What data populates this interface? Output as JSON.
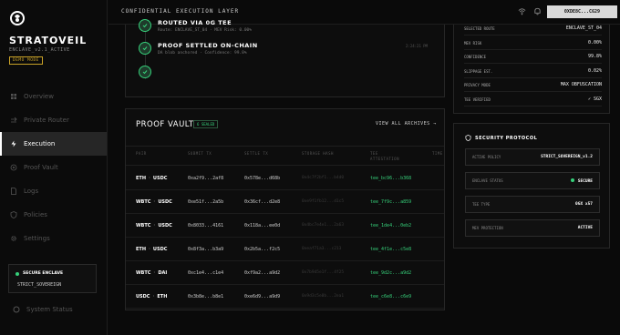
{
  "brand": {
    "name": "STRATOVEIL",
    "enclave": "ENCLAVE_v2.1_ACTIVE",
    "mode_badge": "DEMO MODE"
  },
  "nav": [
    {
      "label": "Overview",
      "icon": "grid-icon"
    },
    {
      "label": "Private Router",
      "icon": "arrows-icon"
    },
    {
      "label": "Execution",
      "icon": "bolt-icon",
      "active": true
    },
    {
      "label": "Proof Vault",
      "icon": "vault-icon"
    },
    {
      "label": "Logs",
      "icon": "document-icon"
    },
    {
      "label": "Policies",
      "icon": "shield-icon"
    },
    {
      "label": "Settings",
      "icon": "gear-icon"
    }
  ],
  "secure_card": {
    "title": "SECURE ENCLAVE",
    "value": "STRICT_SOVEREIGN"
  },
  "system_status": "System Status",
  "topbar": {
    "title": "CONFIDENTIAL EXECUTION LAYER",
    "wallet": "0XDE8C...C629"
  },
  "timeline": [
    {
      "title": "ROUTED VIA 0G TEE",
      "sub": "Route: ENCLAVE_ST_04 · MEV Risk: 0.00%"
    },
    {
      "title": "PROOF SETTLED ON-CHAIN",
      "sub": "DA blob anchored · Confidence: 99.8%"
    }
  ],
  "timeline_time": "2:24:21 PM",
  "vault": {
    "title": "PROOF VAULT",
    "badge": "6 SEALED",
    "link": "VIEW ALL ARCHIVES →",
    "columns": [
      "PAIR",
      "SUBMIT TX",
      "SETTLE TX",
      "STORAGE HASH",
      "TEE ATTESTATION",
      "TIME"
    ],
    "rows": [
      {
        "a": "ETH",
        "b": "USDC",
        "submit": "0xa2f9...2af8",
        "settle": "0x578e...d68b",
        "storage": "0x4c7f2bf1...b4d0",
        "tee": "tee_bc96...b368"
      },
      {
        "a": "WBTC",
        "b": "USDC",
        "submit": "0xe51f...2a5b",
        "settle": "0x36cf...d2e8",
        "storage": "0xe9f1fb12...d1c5",
        "tee": "tee_7f9c...a859"
      },
      {
        "a": "WBTC",
        "b": "USDC",
        "submit": "0x8033...4161",
        "settle": "0x118a...ee0d",
        "storage": "0x4bc7e4e1...2a63",
        "tee": "tee_1de4...0eb2"
      },
      {
        "a": "ETH",
        "b": "USDC",
        "submit": "0x8f3a...b3a9",
        "settle": "0x2b5a...f2c5",
        "storage": "0xeaf71a3...c213",
        "tee": "tee_4f1e...c5e8"
      },
      {
        "a": "WBTC",
        "b": "DAI",
        "submit": "0xc1e4...c1e4",
        "settle": "0xf9a2...a9d2",
        "storage": "0x7b9d5e1f...4f25",
        "tee": "tee_9d2c...a9d2"
      },
      {
        "a": "USDC",
        "b": "ETH",
        "submit": "0x3b8e...b8e1",
        "settle": "0xe6d9...a9d9",
        "storage": "0x9d3c5e8b...2ea1",
        "tee": "tee_c6e8...c6e9"
      }
    ]
  },
  "metrics": [
    {
      "label": "SELECTED ROUTE",
      "value": "ENCLAVE_ST_04"
    },
    {
      "label": "MEV RISK",
      "value": "0.00%",
      "green": true
    },
    {
      "label": "CONFIDENCE",
      "value": "99.8%",
      "green": true
    },
    {
      "label": "SLIPPAGE EST.",
      "value": "0.02%"
    },
    {
      "label": "PRIVACY MODE",
      "value": "MAX OBFUSCATION"
    },
    {
      "label": "TEE VERIFIED",
      "value": "✓ SGX",
      "green": true
    }
  ],
  "security": {
    "title": "SECURITY PROTOCOL",
    "fields": [
      {
        "label": "ACTIVE POLICY",
        "value": "STRICT_SOVEREIGN_v1.2"
      },
      {
        "label": "ENCLAVE STATUS",
        "value": "SECURE",
        "dot": true
      },
      {
        "label": "TEE TYPE",
        "value": "0GX x57"
      },
      {
        "label": "MEV PROTECTION",
        "value": "ACTIVE",
        "green": true
      }
    ]
  },
  "colors": {
    "accent_green": "#36d07a",
    "badge_gold": "#c9a227"
  }
}
